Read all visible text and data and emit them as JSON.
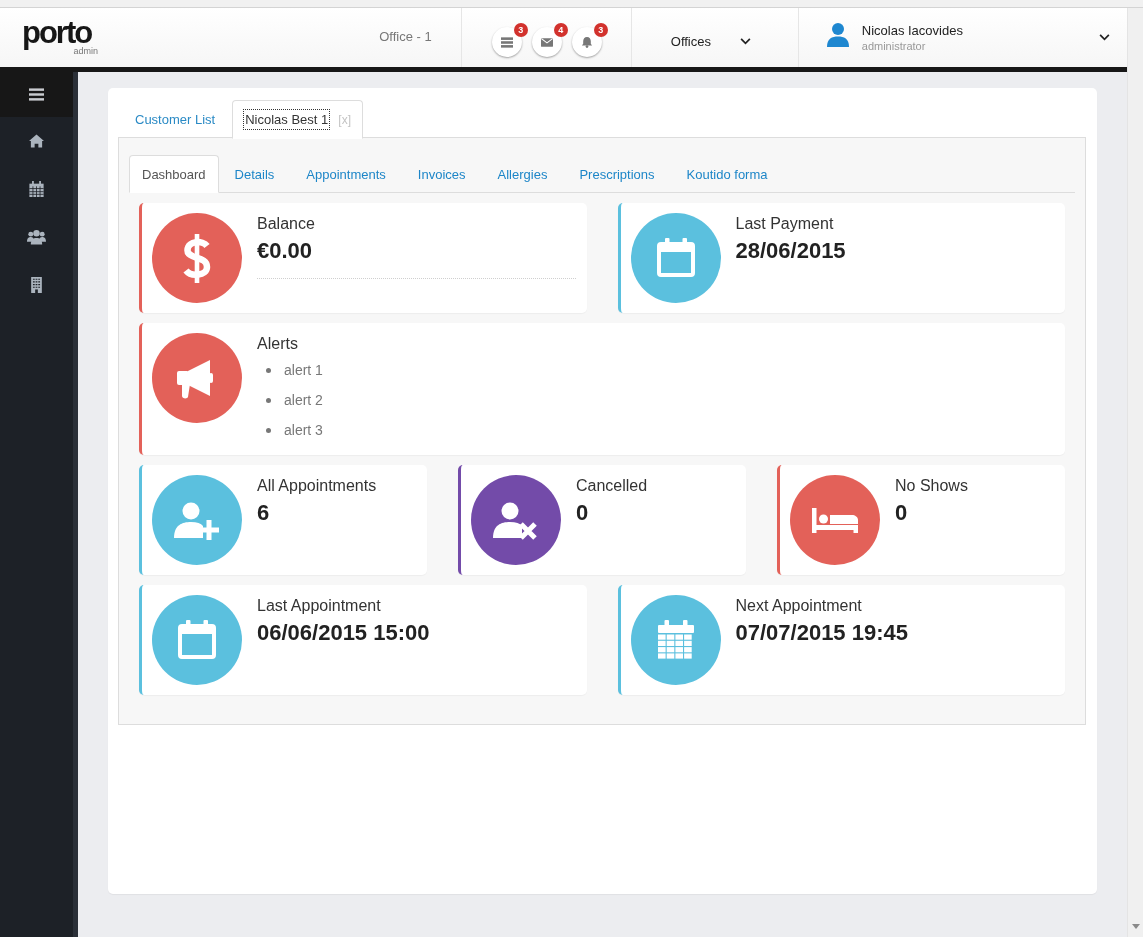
{
  "header": {
    "logo": "porto",
    "logo_subtitle": "admin",
    "office": "Office - 1",
    "notifications": [
      {
        "count": "3"
      },
      {
        "count": "4"
      },
      {
        "count": "3"
      }
    ],
    "offices_menu": "Offices",
    "user": {
      "name": "Nicolas Iacovides",
      "role": "administrator"
    }
  },
  "record_tabs": [
    {
      "label": "Customer List",
      "selected": false,
      "focused": false
    },
    {
      "label": "Nicolas Best 1",
      "selected": true,
      "focused": true,
      "close": "[x]"
    }
  ],
  "section_tabs": [
    {
      "label": "Dashboard",
      "selected": true
    },
    {
      "label": "Details",
      "selected": false
    },
    {
      "label": "Appointments",
      "selected": false
    },
    {
      "label": "Invoices",
      "selected": false
    },
    {
      "label": "Allergies",
      "selected": false
    },
    {
      "label": "Prescriptions",
      "selected": false
    },
    {
      "label": "Koutido forma",
      "selected": false
    }
  ],
  "dashboard": {
    "balance": {
      "title": "Balance",
      "value": "€0.00",
      "color": "#e36159"
    },
    "last_payment": {
      "title": "Last Payment",
      "value": "28/06/2015",
      "color": "#5bc0de"
    },
    "alerts": {
      "title": "Alerts",
      "items": [
        "alert 1",
        "alert 2",
        "alert 3"
      ],
      "color": "#e36159"
    },
    "all_appointments": {
      "title": "All Appointments",
      "value": "6",
      "color": "#5bc0de"
    },
    "cancelled": {
      "title": "Cancelled",
      "value": "0",
      "color": "#734ba9"
    },
    "no_shows": {
      "title": "No Shows",
      "value": "0",
      "color": "#e36159"
    },
    "last_appointment": {
      "title": "Last Appointment",
      "value": "06/06/2015 15:00",
      "color": "#5bc0de"
    },
    "next_appointment": {
      "title": "Next Appointment",
      "value": "07/07/2015 19:45",
      "color": "#5bc0de"
    }
  }
}
